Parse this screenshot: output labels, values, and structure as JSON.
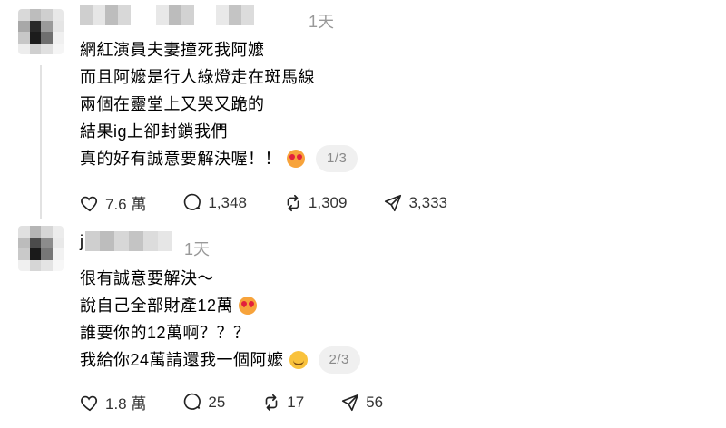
{
  "posts": [
    {
      "time": "1天",
      "lines": [
        "網紅演員夫妻撞死我阿嬤",
        "而且阿嬤是行人綠燈走在斑馬線",
        "兩個在靈堂上又哭又跪的",
        "結果ig上卻封鎖我們",
        "真的好有誠意要解決喔！！"
      ],
      "emoji": "heart-eyes-emoji",
      "page": "1/3",
      "likes": "7.6 萬",
      "comments": "1,348",
      "reposts": "1,309",
      "shares": "3,333"
    },
    {
      "name_initial": "j",
      "time": "1天",
      "lines": [
        "很有誠意要解決～",
        "說自己全部財產12萬",
        "誰要你的12萬啊？？？",
        "我給你24萬請還我一個阿嬤"
      ],
      "emoji_line2": "heart-eyes-emoji",
      "emoji": "smiling-emoji",
      "page": "2/3",
      "likes": "1.8 萬",
      "comments": "25",
      "reposts": "17",
      "shares": "56"
    }
  ],
  "colors": {
    "muted": "#999999",
    "badge_bg": "#f0f0f0",
    "thread_line": "#e2e2e2"
  }
}
